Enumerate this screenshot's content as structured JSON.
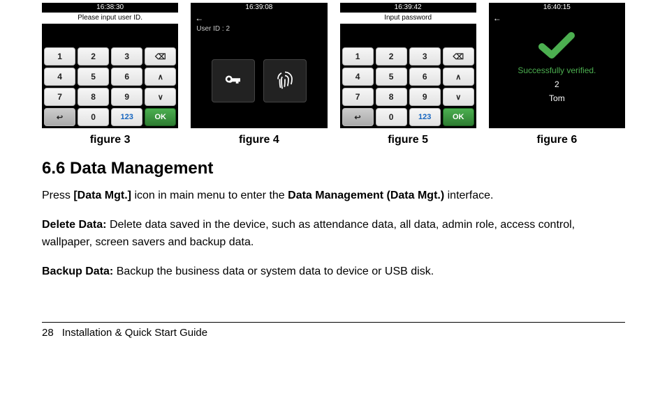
{
  "figures": {
    "fig3": {
      "time": "16:38:30",
      "title": "Please input user ID.",
      "keys": [
        "1",
        "2",
        "3",
        "⌫",
        "4",
        "5",
        "6",
        "∧",
        "7",
        "8",
        "9",
        "∨",
        "↩",
        "0",
        "123",
        "OK"
      ],
      "caption": "figure 3"
    },
    "fig4": {
      "time": "16:39:08",
      "back": "←",
      "user_label": "User ID : 2",
      "caption": "figure 4"
    },
    "fig5": {
      "time": "16:39:42",
      "title": "Input password",
      "keys": [
        "1",
        "2",
        "3",
        "⌫",
        "4",
        "5",
        "6",
        "∧",
        "7",
        "8",
        "9",
        "∨",
        "↩",
        "0",
        "123",
        "OK"
      ],
      "caption": "figure 5"
    },
    "fig6": {
      "time": "16:40:15",
      "back": "←",
      "verified": "Successfully verified.",
      "id": "2",
      "name": "Tom",
      "caption": "figure 6"
    }
  },
  "section": {
    "heading": "6.6 Data Management",
    "p1_pre": "Press ",
    "p1_b1": "[Data Mgt.]",
    "p1_mid": " icon in main menu to enter the ",
    "p1_b2": "Data Management (Data Mgt.)",
    "p1_post": " interface.",
    "p2_b": "Delete Data:",
    "p2": " Delete data saved in the device, such as attendance data, all data, admin role, access control, wallpaper, screen savers and backup data.",
    "p3_b": "Backup Data:",
    "p3": " Backup the business data or system data to device or USB disk."
  },
  "footer": {
    "page": "28",
    "title": "Installation & Quick Start Guide"
  }
}
